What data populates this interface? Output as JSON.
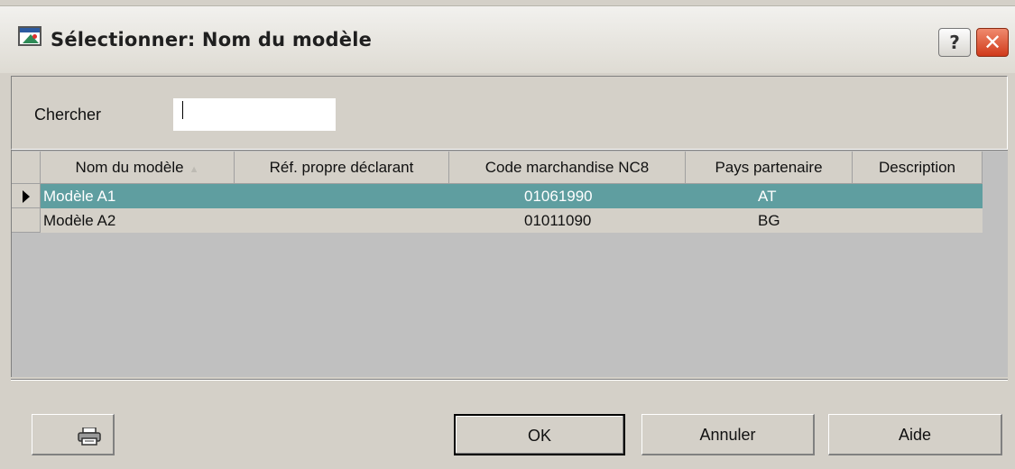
{
  "window": {
    "title": "Sélectionner: Nom du modèle"
  },
  "search": {
    "label": "Chercher",
    "value": "",
    "placeholder": ""
  },
  "grid": {
    "columns": [
      "Nom du modèle",
      "Réf. propre déclarant",
      "Code marchandise NC8",
      "Pays partenaire",
      "Description"
    ],
    "rows": [
      {
        "nom": "Modèle A1",
        "ref": "",
        "code": "01061990",
        "pays": "AT",
        "description": "",
        "selected": true
      },
      {
        "nom": "Modèle A2",
        "ref": "",
        "code": "01011090",
        "pays": "BG",
        "description": "",
        "selected": false
      }
    ]
  },
  "buttons": {
    "print_icon": "printer-icon",
    "ok": "OK",
    "cancel": "Annuler",
    "help": "Aide"
  },
  "colors": {
    "selection": "#5f9ea0",
    "background": "#d4d0c8",
    "close": "#d03a1a"
  }
}
